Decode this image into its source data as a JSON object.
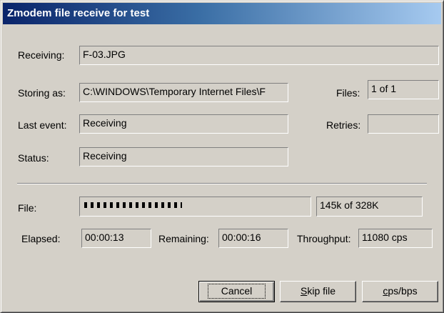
{
  "window": {
    "title": "Zmodem file receive for test"
  },
  "labels": {
    "receiving": "Receiving:",
    "storing_as": "Storing as:",
    "last_event": "Last event:",
    "status": "Status:",
    "files": "Files:",
    "retries": "Retries:",
    "file": "File:",
    "elapsed": "Elapsed:",
    "remaining": "Remaining:",
    "throughput": "Throughput:"
  },
  "values": {
    "receiving": "F-03.JPG",
    "storing_as": "C:\\WINDOWS\\Temporary Internet Files\\F",
    "last_event": "Receiving",
    "status": "Receiving",
    "files": "1 of 1",
    "retries": "",
    "file_progress_text": "145k of 328K",
    "file_progress_fraction": 0.44,
    "elapsed": "00:00:13",
    "remaining": "00:00:16",
    "throughput": "11080 cps"
  },
  "buttons": {
    "cancel": "Cancel",
    "skip_file_mnemonic": "S",
    "skip_file_rest": "kip file",
    "cps_bps_mnemonic": "c",
    "cps_bps_rest": "ps/bps"
  }
}
